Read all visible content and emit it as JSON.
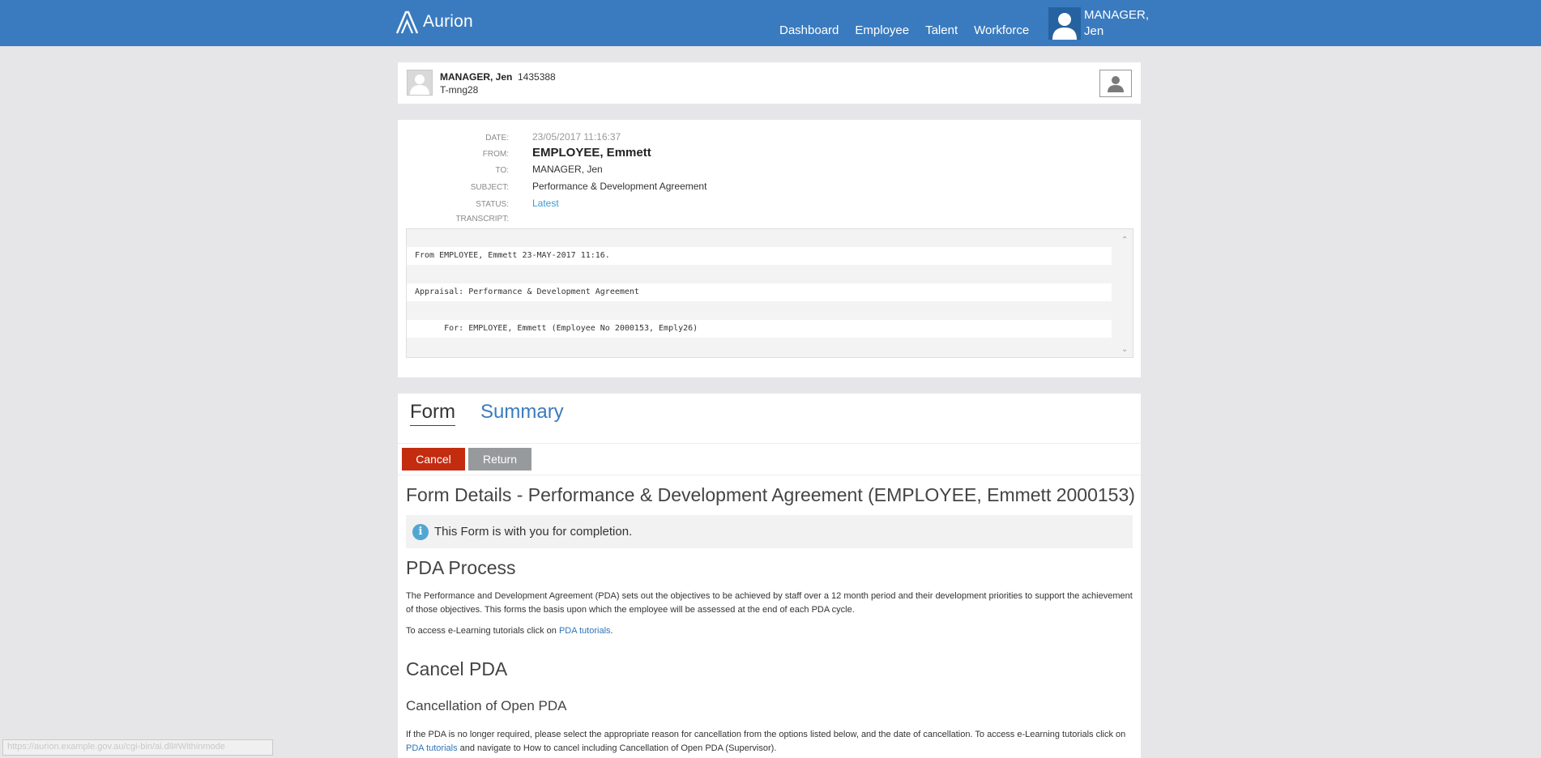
{
  "nav": {
    "logo_text": "Aurion",
    "items": [
      "Dashboard",
      "Employee",
      "Talent",
      "Workforce"
    ],
    "user_name": "MANAGER, Jen"
  },
  "employee": {
    "name": "MANAGER, Jen",
    "id": "1435388",
    "code": "T-mng28"
  },
  "message": {
    "date_label": "DATE:",
    "date": "23/05/2017 11:16:37",
    "from_label": "FROM:",
    "from": "EMPLOYEE, Emmett",
    "to_label": "TO:",
    "to": "MANAGER, Jen",
    "subject_label": "SUBJECT:",
    "subject": "Performance & Development Agreement",
    "status_label": "STATUS:",
    "status": "Latest",
    "transcript_label": "TRANSCRIPT:",
    "transcript_lines": [
      "From EMPLOYEE, Emmett 23-MAY-2017 11:16.",
      "Appraisal: Performance & Development Agreement",
      "      For: EMPLOYEE, Emmett (Employee No 2000153, Emply26)"
    ]
  },
  "tabs": {
    "form": "Form",
    "summary": "Summary"
  },
  "buttons": {
    "cancel": "Cancel",
    "return": "Return"
  },
  "form": {
    "title": "Form Details - Performance & Development Agreement (EMPLOYEE, Emmett 2000153)",
    "info_icon": "i",
    "info": "This Form is with you for completion.",
    "pda_heading": "PDA Process",
    "pda_text": "The Performance and Development Agreement (PDA) sets out the objectives to be achieved by staff over a 12 month period and their development priorities to support the achievement of those objectives. This forms the basis upon which the employee will be assessed at the end of each PDA cycle.",
    "tutorial_prefix": "To access e-Learning tutorials click on ",
    "tutorial_link": "PDA tutorials",
    "tutorial_suffix": ".",
    "cancel_heading": "Cancel PDA",
    "cancellation_heading": "Cancellation of Open PDA",
    "cancellation_text": "If the PDA is no longer required, please select the appropriate reason for cancellation from the options listed below, and the date of cancellation. To access e-Learning tutorials click on ",
    "cancellation_link": "PDA tutorials",
    "cancellation_suffix": " and navigate to How to cancel including Cancellation of Open PDA (Supervisor)."
  },
  "statusbar": "https://aurion.example.gov.au/cgi-bin/ai.dll#Withinmode"
}
